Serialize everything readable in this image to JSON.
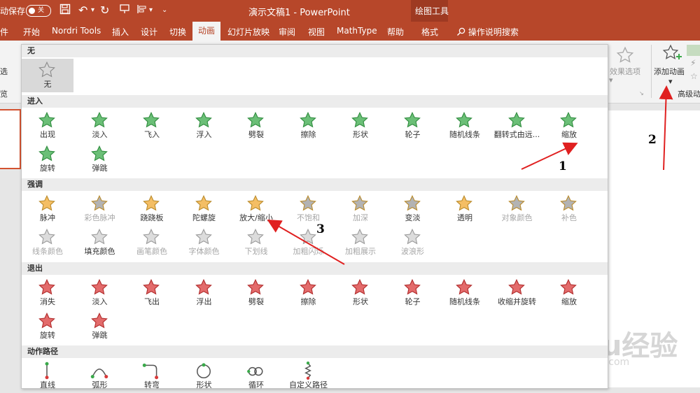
{
  "titlebar": {
    "autosave": "动保存",
    "autosave_state": "关",
    "doc_title": "演示文稿1 - PowerPoint",
    "tool_group": "绘图工具"
  },
  "tabs": [
    "件",
    "开始",
    "Nordri Tools",
    "插入",
    "设计",
    "切换",
    "动画",
    "幻灯片放映",
    "审阅",
    "视图",
    "MathType",
    "帮助",
    "格式"
  ],
  "search": "操作说明搜索",
  "ribbon": {
    "left_partial_1": "选",
    "left_partial_2": "览",
    "effect_options": "效果选项",
    "add_animation": "添加动画",
    "advanced": "高级动"
  },
  "sections": {
    "none": "无",
    "entrance": "进入",
    "emphasis": "强调",
    "exit": "退出",
    "paths": "动作路径"
  },
  "none_item": "无",
  "entrance": [
    "出现",
    "淡入",
    "飞入",
    "浮入",
    "劈裂",
    "擦除",
    "形状",
    "轮子",
    "随机线条",
    "翻转式由远...",
    "缩放",
    "旋转",
    "弹跳"
  ],
  "emphasis": [
    "脉冲",
    "彩色脉冲",
    "跷跷板",
    "陀螺旋",
    "放大/缩小",
    "不饱和",
    "加深",
    "变淡",
    "透明",
    "对象颜色",
    "补色",
    "线条颜色",
    "填充颜色",
    "画笔颜色",
    "字体颜色",
    "下划线",
    "加粗闪烁",
    "加粗展示",
    "波浪形"
  ],
  "exit": [
    "消失",
    "淡入",
    "飞出",
    "浮出",
    "劈裂",
    "擦除",
    "形状",
    "轮子",
    "随机线条",
    "收缩并旋转",
    "缩放",
    "旋转",
    "弹跳"
  ],
  "paths": [
    "直线",
    "弧形",
    "转弯",
    "形状",
    "循环",
    "自定义路径"
  ],
  "annotations": [
    "1",
    "2",
    "3"
  ],
  "watermark": {
    "logo": "Baidu经验",
    "url": "jingyan.baidu.com"
  },
  "colors": {
    "titlebar": "#b7472a",
    "entrance": "#3aa94a",
    "exit": "#d93a3a",
    "emphasis": "#f0a830",
    "gray": "#9a9a9a",
    "arrow": "#e02020"
  }
}
